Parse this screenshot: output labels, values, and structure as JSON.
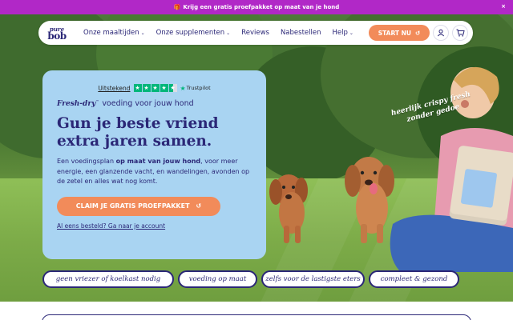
{
  "promo": {
    "icon": "gift-icon",
    "text": "Krijg een gratis proefpakket op maat van je hond",
    "close_icon": "close-icon"
  },
  "nav": {
    "logo_line1": "pure",
    "logo_line2": "bob",
    "items": [
      {
        "label": "Onze maaltijden",
        "dropdown": true
      },
      {
        "label": "Onze supplementen",
        "dropdown": true
      },
      {
        "label": "Reviews",
        "dropdown": false
      },
      {
        "label": "Nabestellen",
        "dropdown": false
      },
      {
        "label": "Help",
        "dropdown": true
      }
    ],
    "start_label": "START NU",
    "account_icon": "user-icon",
    "cart_icon": "cart-icon"
  },
  "hero": {
    "rating_label": "Uitstekend",
    "stars": 4.5,
    "trustpilot_label": "Trustpilot",
    "tagline_brand": "Fresh-dry",
    "tagline_tm": "™",
    "tagline_rest": "voeding voor jouw hond",
    "headline_line1": "Gun je beste vriend",
    "headline_line2": "extra jaren samen.",
    "body_part1": "Een voedingsplan ",
    "body_bold": "op maat van jouw hond",
    "body_part2": ", voor meer energie, een glanzende vacht, en wandelingen, avonden op de zetel en alles wat nog komt.",
    "cta_label": "CLAIM JE GRATIS PROEFPAKKET",
    "account_link": "Al eens besteld? Ga naar je account",
    "handwritten": "heerlijk crispy fresh zonder gedoe"
  },
  "pills": [
    "geen vriezer of koelkast nodig",
    "voeding op maat",
    "zelfs voor de lastigste eters",
    "compleet & gezond"
  ],
  "colors": {
    "navy": "#2b2777",
    "orange": "#f28b5a",
    "card_blue": "#a9d4f2",
    "promo_purple": "#b128c7",
    "trustpilot_green": "#00b67a"
  }
}
